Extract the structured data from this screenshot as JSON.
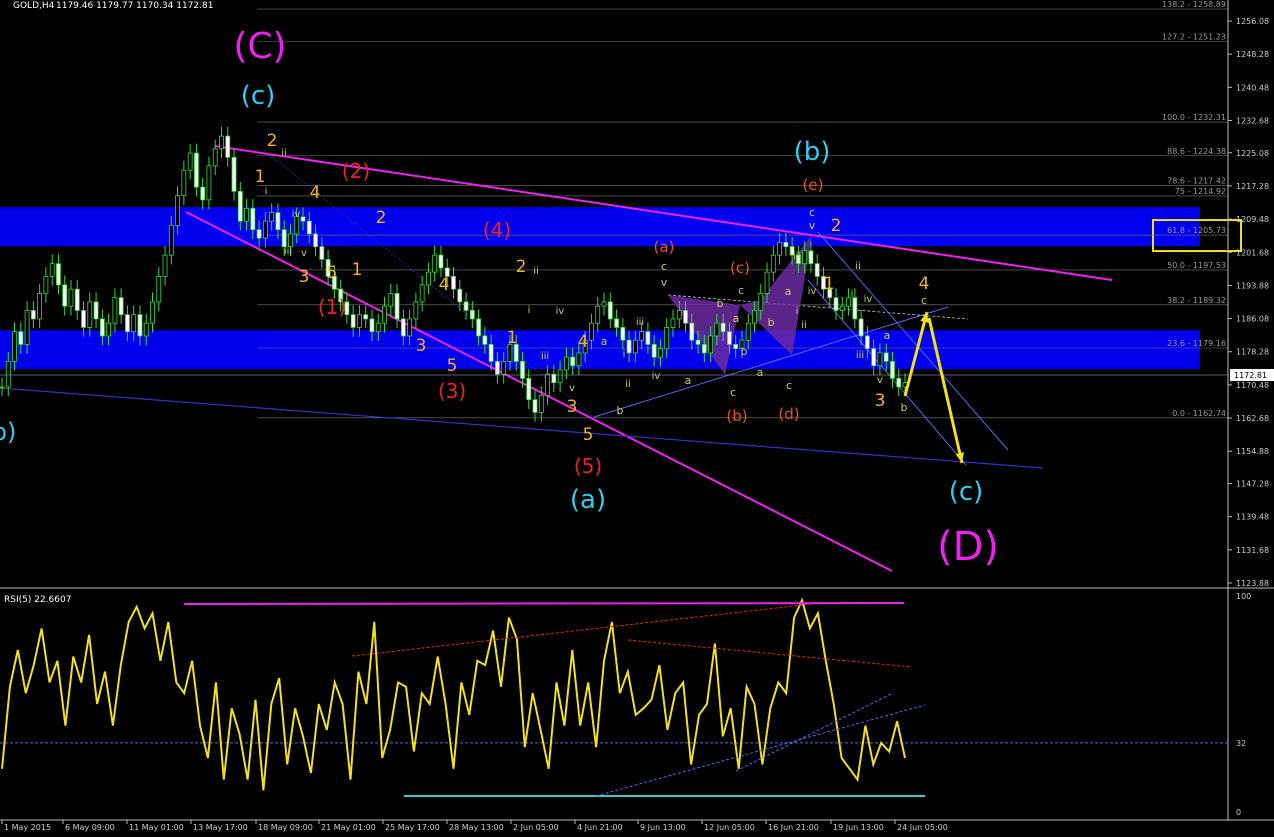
{
  "window": {
    "symbol_label": "GOLD,H4",
    "ohlc": "1179.46 1179.77 1170.34 1172.81"
  },
  "price_axis": {
    "labels": [
      "1256.08",
      "1248.28",
      "1240.48",
      "1232.68",
      "1225.08",
      "1217.28",
      "1209.48",
      "1201.68",
      "1193.88",
      "1186.08",
      "1178.28",
      "1170.48",
      "1162.68",
      "1154.88",
      "1147.28",
      "1139.48",
      "1131.68",
      "1123.88"
    ],
    "current_price": "1172.81"
  },
  "time_axis": {
    "labels": [
      "1 May 2015",
      "6 May 09:00",
      "11 May 01:00",
      "13 May 17:00",
      "18 May 09:00",
      "21 May 01:00",
      "25 May 17:00",
      "28 May 13:00",
      "2 Jun 05:00",
      "4 Jun 21:00",
      "9 Jun 13:00",
      "12 Jun 05:00",
      "16 Jun 21:00",
      "19 Jun 13:00",
      "24 Jun 05:00"
    ]
  },
  "fibonacci": [
    {
      "label": "138.2 - 1258.89",
      "price": 1258.89
    },
    {
      "label": "127.2 - 1251.23",
      "price": 1251.23
    },
    {
      "label": "100.0 - 1232.31",
      "price": 1232.31
    },
    {
      "label": "88.6 - 1224.38",
      "price": 1224.38
    },
    {
      "label": "78.6 - 1217.42",
      "price": 1217.42
    },
    {
      "label": "75 - 1214.92",
      "price": 1214.92
    },
    {
      "label": "61.8 - 1205.73",
      "price": 1205.73
    },
    {
      "label": "50.0 - 1197.53",
      "price": 1197.53
    },
    {
      "label": "38.2 - 1189.32",
      "price": 1189.32
    },
    {
      "label": "23.6 - 1179.16",
      "price": 1179.16
    },
    {
      "label": "0.0 - 1162.74",
      "price": 1162.74
    }
  ],
  "zones": [
    {
      "from": 1203.1,
      "to": 1212.3,
      "color": "#0000ee"
    },
    {
      "from": 1174.2,
      "to": 1183.3,
      "color": "#0000ee"
    }
  ],
  "wave_labels": [
    {
      "text": "(C)",
      "color": "#ee22ee",
      "size": 36,
      "x": 260,
      "y": 58
    },
    {
      "text": "(c)",
      "color": "#33ccee",
      "size": 26,
      "x": 258,
      "y": 104
    },
    {
      "text": "(b)",
      "color": "#33ccee",
      "size": 26,
      "x": 812,
      "y": 160
    },
    {
      "text": "(e)",
      "color": "#ee5511",
      "size": 15,
      "x": 813,
      "y": 190
    },
    {
      "text": "(a)",
      "color": "#33ccee",
      "size": 26,
      "x": 588,
      "y": 508
    },
    {
      "text": "(c)",
      "color": "#33ccee",
      "size": 26,
      "x": 966,
      "y": 500
    },
    {
      "text": "(D)",
      "color": "#ee22ee",
      "size": 40,
      "x": 968,
      "y": 560
    },
    {
      "text": "b)",
      "color": "#33ccee",
      "size": 24,
      "x": 4,
      "y": 440
    },
    {
      "text": "(2)",
      "color": "#ee2222",
      "size": 20,
      "x": 356,
      "y": 178
    },
    {
      "text": "(4)",
      "color": "#ee2222",
      "size": 20,
      "x": 497,
      "y": 237
    },
    {
      "text": "(1)",
      "color": "#ee2222",
      "size": 20,
      "x": 332,
      "y": 314
    },
    {
      "text": "(3)",
      "color": "#ee2222",
      "size": 20,
      "x": 452,
      "y": 398
    },
    {
      "text": "(5)",
      "color": "#ee2222",
      "size": 20,
      "x": 588,
      "y": 473
    },
    {
      "text": "(a)",
      "color": "#ee5511",
      "size": 15,
      "x": 664,
      "y": 252
    },
    {
      "text": "(c)",
      "color": "#ee5511",
      "size": 15,
      "x": 740,
      "y": 273
    },
    {
      "text": "(b)",
      "color": "#ee5511",
      "size": 15,
      "x": 737,
      "y": 421
    },
    {
      "text": "(d)",
      "color": "#ee5511",
      "size": 15,
      "x": 789,
      "y": 419
    },
    {
      "text": "2",
      "color": "#f4b320",
      "size": 17,
      "x": 272,
      "y": 146
    },
    {
      "text": "1",
      "color": "#f4b320",
      "size": 17,
      "x": 260,
      "y": 182
    },
    {
      "text": "4",
      "color": "#f4b320",
      "size": 17,
      "x": 315,
      "y": 198
    },
    {
      "text": "2",
      "color": "#f4b320",
      "size": 17,
      "x": 381,
      "y": 223
    },
    {
      "text": "3",
      "color": "#f4b320",
      "size": 17,
      "x": 304,
      "y": 282
    },
    {
      "text": "5",
      "color": "#f4b320",
      "size": 17,
      "x": 332,
      "y": 278
    },
    {
      "text": "1",
      "color": "#f4b320",
      "size": 17,
      "x": 357,
      "y": 275
    },
    {
      "text": "4",
      "color": "#f4b320",
      "size": 17,
      "x": 444,
      "y": 290
    },
    {
      "text": "2",
      "color": "#f4b320",
      "size": 17,
      "x": 521,
      "y": 272
    },
    {
      "text": "1",
      "color": "#f4b320",
      "size": 17,
      "x": 512,
      "y": 343
    },
    {
      "text": "3",
      "color": "#f4b320",
      "size": 17,
      "x": 421,
      "y": 351
    },
    {
      "text": "5",
      "color": "#f4b320",
      "size": 17,
      "x": 452,
      "y": 371
    },
    {
      "text": "4",
      "color": "#f4b320",
      "size": 17,
      "x": 583,
      "y": 347
    },
    {
      "text": "3",
      "color": "#f4b320",
      "size": 17,
      "x": 572,
      "y": 412
    },
    {
      "text": "5",
      "color": "#f4b320",
      "size": 17,
      "x": 588,
      "y": 440
    },
    {
      "text": "2",
      "color": "#f4b320",
      "size": 17,
      "x": 836,
      "y": 231
    },
    {
      "text": "1",
      "color": "#f4b320",
      "size": 17,
      "x": 829,
      "y": 289
    },
    {
      "text": "4",
      "color": "#f4b320",
      "size": 17,
      "x": 924,
      "y": 289
    },
    {
      "text": "3",
      "color": "#f4b320",
      "size": 17,
      "x": 880,
      "y": 406
    },
    {
      "text": "c",
      "color": "#cccc66",
      "size": 11,
      "x": 664,
      "y": 270
    },
    {
      "text": "v",
      "color": "#cccc66",
      "size": 11,
      "x": 664,
      "y": 286
    },
    {
      "text": "b",
      "color": "#cccc66",
      "size": 11,
      "x": 720,
      "y": 307
    },
    {
      "text": "c",
      "color": "#cccc66",
      "size": 11,
      "x": 741,
      "y": 294
    },
    {
      "text": "a",
      "color": "#cccc66",
      "size": 11,
      "x": 736,
      "y": 322
    },
    {
      "text": "b",
      "color": "#cccc66",
      "size": 11,
      "x": 771,
      "y": 326
    },
    {
      "text": "a",
      "color": "#cccc66",
      "size": 11,
      "x": 788,
      "y": 295
    },
    {
      "text": "c",
      "color": "#cccc66",
      "size": 11,
      "x": 812,
      "y": 216
    },
    {
      "text": "v",
      "color": "#cccc66",
      "size": 11,
      "x": 812,
      "y": 229
    },
    {
      "text": "c",
      "color": "#cccc66",
      "size": 11,
      "x": 924,
      "y": 304
    },
    {
      "text": "a",
      "color": "#cccc66",
      "size": 11,
      "x": 604,
      "y": 345
    },
    {
      "text": "b",
      "color": "#cccc66",
      "size": 11,
      "x": 620,
      "y": 414
    },
    {
      "text": "a",
      "color": "#cccc66",
      "size": 11,
      "x": 688,
      "y": 384
    },
    {
      "text": "b",
      "color": "#cccc66",
      "size": 11,
      "x": 744,
      "y": 355
    },
    {
      "text": "a",
      "color": "#cccc66",
      "size": 11,
      "x": 760,
      "y": 376
    },
    {
      "text": "c",
      "color": "#cccc66",
      "size": 11,
      "x": 733,
      "y": 396
    },
    {
      "text": "c",
      "color": "#cccc66",
      "size": 11,
      "x": 789,
      "y": 389
    },
    {
      "text": "a",
      "color": "#cccc66",
      "size": 11,
      "x": 887,
      "y": 339
    },
    {
      "text": "b",
      "color": "#cccc66",
      "size": 11,
      "x": 904,
      "y": 411
    },
    {
      "text": "ii",
      "color": "#cccc66",
      "size": 10,
      "x": 284,
      "y": 156
    },
    {
      "text": "i",
      "color": "#cccc66",
      "size": 10,
      "x": 266,
      "y": 194
    },
    {
      "text": "iv",
      "color": "#cccc66",
      "size": 10,
      "x": 296,
      "y": 217
    },
    {
      "text": "iii",
      "color": "#cccc66",
      "size": 10,
      "x": 288,
      "y": 254
    },
    {
      "text": "v",
      "color": "#cccc66",
      "size": 10,
      "x": 304,
      "y": 256
    },
    {
      "text": "ii",
      "color": "#cccc66",
      "size": 10,
      "x": 536,
      "y": 274
    },
    {
      "text": "i",
      "color": "#cccc66",
      "size": 10,
      "x": 529,
      "y": 313
    },
    {
      "text": "iv",
      "color": "#cccc66",
      "size": 10,
      "x": 560,
      "y": 314
    },
    {
      "text": "iii",
      "color": "#cccc66",
      "size": 10,
      "x": 545,
      "y": 359
    },
    {
      "text": "v",
      "color": "#cccc66",
      "size": 10,
      "x": 572,
      "y": 391
    },
    {
      "text": "iii",
      "color": "#cccc66",
      "size": 10,
      "x": 640,
      "y": 325
    },
    {
      "text": "i",
      "color": "#cccc66",
      "size": 10,
      "x": 624,
      "y": 357
    },
    {
      "text": "iv",
      "color": "#cccc66",
      "size": 10,
      "x": 656,
      "y": 379
    },
    {
      "text": "ii",
      "color": "#cccc66",
      "size": 10,
      "x": 628,
      "y": 387
    },
    {
      "text": "iii",
      "color": "#cccc66",
      "size": 10,
      "x": 797,
      "y": 259
    },
    {
      "text": "iv",
      "color": "#cccc66",
      "size": 10,
      "x": 812,
      "y": 294
    },
    {
      "text": "ii",
      "color": "#cccc66",
      "size": 10,
      "x": 804,
      "y": 328
    },
    {
      "text": "i",
      "color": "#cccc66",
      "size": 10,
      "x": 797,
      "y": 314
    },
    {
      "text": "ii",
      "color": "#cccc66",
      "size": 10,
      "x": 858,
      "y": 269
    },
    {
      "text": "i",
      "color": "#cccc66",
      "size": 10,
      "x": 852,
      "y": 297
    },
    {
      "text": "iv",
      "color": "#cccc66",
      "size": 10,
      "x": 868,
      "y": 302
    },
    {
      "text": "iii",
      "color": "#cccc66",
      "size": 10,
      "x": 860,
      "y": 358
    },
    {
      "text": "v",
      "color": "#cccc66",
      "size": 10,
      "x": 880,
      "y": 383
    }
  ],
  "rsi": {
    "title": "RSI(5) 22.6607",
    "axis_labels": [
      "100",
      "32",
      "0"
    ],
    "level": 32,
    "values": [
      20,
      58,
      75,
      55,
      68,
      85,
      60,
      70,
      40,
      72,
      60,
      82,
      50,
      65,
      40,
      68,
      88,
      95,
      85,
      92,
      70,
      88,
      60,
      55,
      70,
      40,
      25,
      60,
      15,
      48,
      36,
      15,
      52,
      10,
      50,
      62,
      22,
      48,
      35,
      18,
      50,
      38,
      60,
      50,
      15,
      65,
      50,
      88,
      25,
      38,
      60,
      58,
      28,
      55,
      50,
      72,
      50,
      20,
      60,
      45,
      70,
      68,
      84,
      58,
      90,
      80,
      30,
      55,
      38,
      20,
      60,
      40,
      75,
      40,
      60,
      30,
      70,
      88,
      55,
      65,
      45,
      48,
      52,
      68,
      38,
      55,
      60,
      22,
      45,
      50,
      78,
      35,
      48,
      20,
      58,
      50,
      22,
      48,
      60,
      55,
      90,
      98,
      85,
      92,
      70,
      50,
      25,
      20,
      15,
      40,
      22,
      32,
      28,
      42,
      25
    ]
  },
  "chart_data": {
    "type": "candlestick",
    "title": "GOLD,H4",
    "ylim": [
      1123.88,
      1262.0
    ],
    "close_series": [
      1170,
      1176,
      1183,
      1180,
      1188,
      1186,
      1192,
      1196,
      1199,
      1194,
      1189,
      1193,
      1188,
      1184,
      1190,
      1186,
      1182,
      1185,
      1191,
      1187,
      1183,
      1187,
      1182,
      1185,
      1190,
      1196,
      1201,
      1208,
      1215,
      1221,
      1225,
      1217,
      1214,
      1222,
      1226,
      1229,
      1224,
      1216,
      1209,
      1212,
      1207,
      1205,
      1209,
      1211,
      1207,
      1203,
      1206,
      1210,
      1209,
      1206,
      1203,
      1200,
      1196,
      1193,
      1190,
      1187,
      1184,
      1187,
      1186,
      1183,
      1185,
      1189,
      1192,
      1186,
      1182,
      1186,
      1190,
      1194,
      1197,
      1201,
      1198,
      1196,
      1193,
      1190,
      1188,
      1186,
      1182,
      1180,
      1176,
      1173,
      1176,
      1180,
      1176,
      1172,
      1167,
      1164,
      1168,
      1173,
      1171,
      1174,
      1177,
      1175,
      1178,
      1181,
      1185,
      1189,
      1190,
      1186,
      1184,
      1181,
      1178,
      1181,
      1183,
      1180,
      1177,
      1179,
      1184,
      1186,
      1188,
      1185,
      1181,
      1180,
      1178,
      1182,
      1185,
      1183,
      1180,
      1179,
      1181,
      1185,
      1188,
      1192,
      1197,
      1201,
      1204,
      1203,
      1201,
      1199,
      1202,
      1199,
      1196,
      1193,
      1191,
      1188,
      1189,
      1191,
      1186,
      1182,
      1179,
      1175,
      1178,
      1176,
      1172,
      1170,
      1171
    ],
    "last_close": 1172.81
  }
}
